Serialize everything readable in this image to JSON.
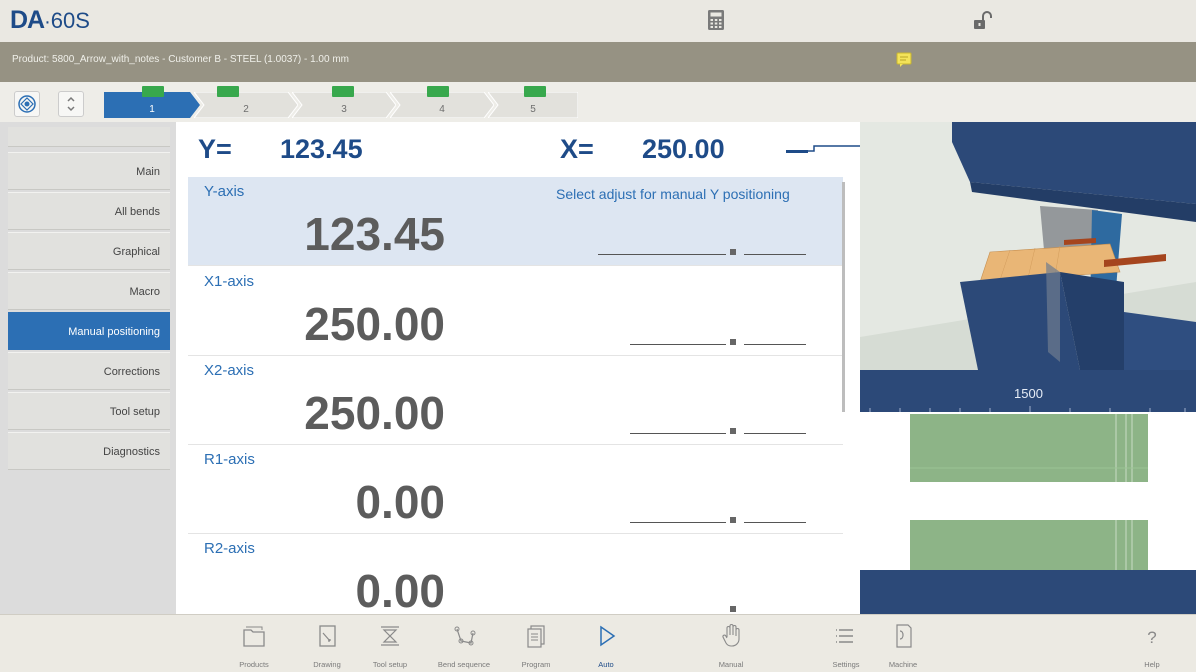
{
  "header": {
    "logo_brand": "DA",
    "logo_sep": "·",
    "logo_model": "60S",
    "calculator_icon": "calculator-icon",
    "lock_icon": "unlock-icon"
  },
  "product_bar": {
    "text": "Product: 5800_Arrow_with_notes - Customer B - STEEL (1.0037) - 1.00 mm",
    "note_icon": "note-icon"
  },
  "steps": [
    {
      "label": "1",
      "active": true
    },
    {
      "label": "2",
      "active": false
    },
    {
      "label": "3",
      "active": false
    },
    {
      "label": "4",
      "active": false
    },
    {
      "label": "5",
      "active": false
    }
  ],
  "sidebar": {
    "items": [
      {
        "label": "Main"
      },
      {
        "label": "All bends"
      },
      {
        "label": "Graphical"
      },
      {
        "label": "Macro"
      },
      {
        "label": "Manual positioning",
        "active": true
      },
      {
        "label": "Corrections"
      },
      {
        "label": "Tool setup"
      },
      {
        "label": "Diagnostics"
      }
    ]
  },
  "main": {
    "y_readout_label": "Y=",
    "y_readout_value": "123.45",
    "x_readout_label": "X=",
    "x_readout_value": "250.00",
    "hint": "Select adjust for manual Y positioning",
    "axes": [
      {
        "label": "Y-axis",
        "value": "123.45"
      },
      {
        "label": "X1-axis",
        "value": "250.00"
      },
      {
        "label": "X2-axis",
        "value": "250.00"
      },
      {
        "label": "R1-axis",
        "value": "0.00"
      },
      {
        "label": "R2-axis",
        "value": "0.00"
      }
    ]
  },
  "view": {
    "ruler_value": "1500"
  },
  "bottom_nav": {
    "items": [
      {
        "label": "Products",
        "icon": "folder-icon"
      },
      {
        "label": "Drawing",
        "icon": "drawing-icon"
      },
      {
        "label": "Tool setup",
        "icon": "tool-setup-icon"
      },
      {
        "label": "Bend sequence",
        "icon": "bend-sequence-icon"
      },
      {
        "label": "Program",
        "icon": "program-icon"
      },
      {
        "label": "Auto",
        "icon": "play-icon",
        "active": true
      },
      {
        "label": "Manual",
        "icon": "hand-icon"
      },
      {
        "label": "Settings",
        "icon": "list-icon"
      },
      {
        "label": "Machine",
        "icon": "machine-icon"
      },
      {
        "label": "Help",
        "icon": "help-icon"
      }
    ]
  },
  "colors": {
    "brand_blue": "#1e4b88",
    "active_blue": "#2c6fb4",
    "badge_green": "#38a84d",
    "product_bar": "#969283"
  }
}
